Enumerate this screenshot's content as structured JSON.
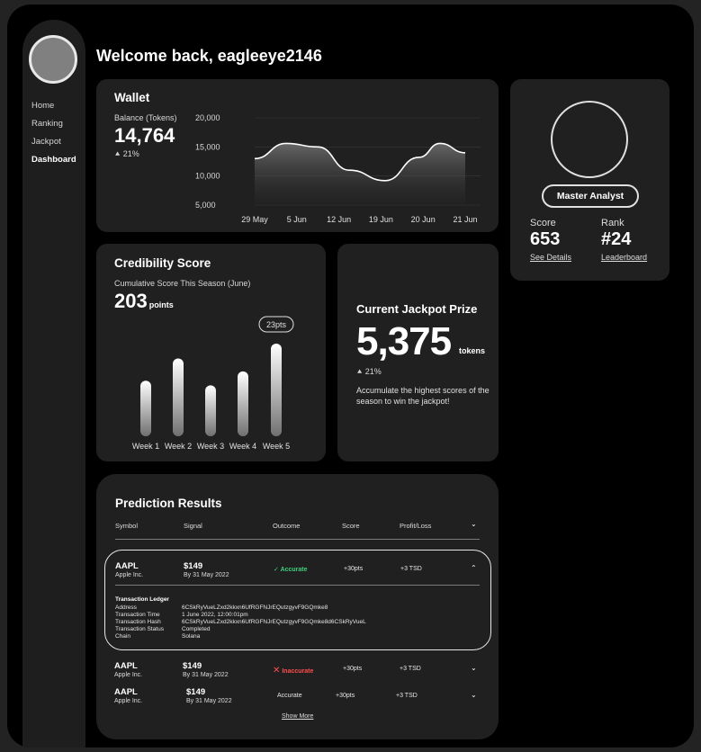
{
  "user": {
    "welcome": "Welcome back, eagleeye2146"
  },
  "nav": {
    "items": [
      "Home",
      "Ranking",
      "Jackpot",
      "Dashboard"
    ],
    "active": "Dashboard"
  },
  "wallet": {
    "title": "Wallet",
    "balance_label": "Balance (Tokens)",
    "balance": "14,764",
    "change": "21%",
    "chart_data": {
      "type": "area",
      "x": [
        "29 May",
        "5 Jun",
        "12 Jun",
        "19 Jun",
        "20 Jun",
        "21 Jun"
      ],
      "y_ticks": [
        "20,000",
        "15,000",
        "10,000",
        "5,000"
      ],
      "ylim": [
        5000,
        20000
      ],
      "points": [
        [
          0,
          13000
        ],
        [
          0.15,
          15600
        ],
        [
          0.3,
          15000
        ],
        [
          0.45,
          11000
        ],
        [
          0.62,
          9200
        ],
        [
          0.78,
          13200
        ],
        [
          0.88,
          15600
        ],
        [
          1.0,
          14000
        ]
      ],
      "grid": true
    }
  },
  "credibility": {
    "title": "Credibility Score",
    "subtitle": "Cumulative Score This Season (June)",
    "value": "203",
    "unit": "points",
    "highlight_label": "23pts",
    "chart_data": {
      "type": "bar",
      "categories": [
        "Week 1",
        "Week 2",
        "Week 3",
        "Week 4",
        "Week 5"
      ],
      "values": [
        60,
        84,
        55,
        70,
        100
      ]
    }
  },
  "jackpot": {
    "title": "Current Jackpot Prize",
    "value": "5,375",
    "unit": "tokens",
    "change": "21%",
    "description": "Accumulate the highest scores of the season to win the jackpot!"
  },
  "profile": {
    "rank_title": "Master Analyst",
    "score_label": "Score",
    "score": "653",
    "score_link": "See Details",
    "rank_label": "Rank",
    "rank": "#24",
    "rank_link": "Leaderboard"
  },
  "predictions": {
    "title": "Prediction Results",
    "headers": [
      "Symbol",
      "Signal",
      "Outcome",
      "Score",
      "Profit/Loss"
    ],
    "rows": [
      {
        "symbol": "AAPL",
        "company": "Apple Inc.",
        "price": "$149",
        "date": "By 31 May 2022",
        "outcome": "Accurate",
        "score": "+30pts",
        "pl": "+3 TSD"
      },
      {
        "symbol": "AAPL",
        "company": "Apple Inc.",
        "price": "$149",
        "date": "By 31 May 2022",
        "outcome": "Inaccurate",
        "score": "+30pts",
        "pl": "+3 TSD"
      },
      {
        "symbol": "AAPL",
        "company": "Apple Inc.",
        "price": "$149",
        "date": "By 31 May 2022",
        "outcome": "Accurate",
        "score": "+30pts",
        "pl": "+3 TSD"
      }
    ],
    "ledger": {
      "title": "Transaction Ledger",
      "rows": [
        {
          "label": "Address",
          "value": "6CSkRyVueLZxd2kkxn6UfRGFNJrEQutzgyvF9GQmke8"
        },
        {
          "label": "Transaction Time",
          "value": "1 June 2022, 12:00:01pm"
        },
        {
          "label": "Transaction Hash",
          "value": "6CSkRyVueLZxd2kkxn6UfRGFNJrEQutzgyvF9GQmke8d6CSkRyVueL"
        },
        {
          "label": "Transaction Status",
          "value": "Completed"
        },
        {
          "label": "Chain",
          "value": "Solana"
        }
      ]
    },
    "show_more": "Show More"
  }
}
